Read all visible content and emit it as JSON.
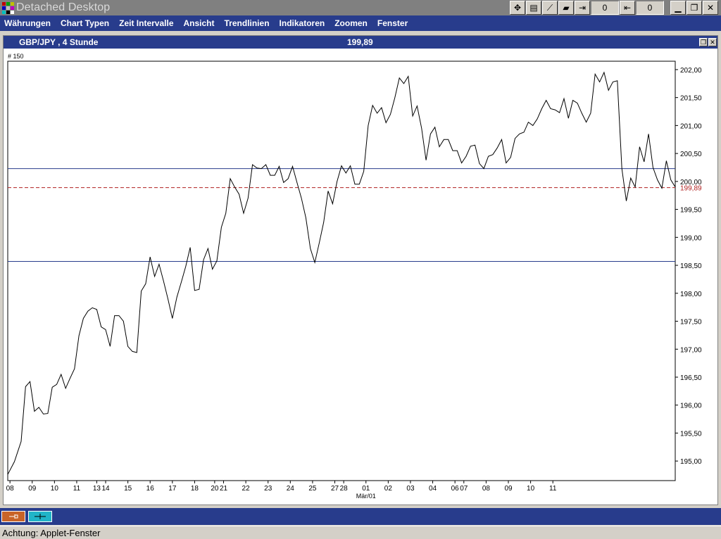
{
  "window": {
    "title": "Detached Desktop",
    "count_left": "0",
    "count_right": "0"
  },
  "menu": [
    "Währungen",
    "Chart Typen",
    "Zeit Intervalle",
    "Ansicht",
    "Trendlinien",
    "Indikatoren",
    "Zoomen",
    "Fenster"
  ],
  "chart_window": {
    "title": "GBP/JPY , 4 Stunde",
    "price": "199,89",
    "bar_count": "# 150"
  },
  "status": {
    "text": "Achtung: Applet-Fenster"
  },
  "colors": {
    "titlebar": "#808080",
    "menubar": "#283c8c",
    "last_price": "#b02020",
    "trendline": "#283c8c",
    "task1": "#c86428",
    "task2": "#20b4c8"
  },
  "chart_data": {
    "type": "line",
    "title": "GBP/JPY , 4 Stunde",
    "ylim": [
      194.65,
      202.15
    ],
    "y_ticks": [
      "195,00",
      "195,50",
      "196,00",
      "196,50",
      "197,00",
      "197,50",
      "198,00",
      "198,50",
      "199,00",
      "199,50",
      "200,00",
      "200,50",
      "201,00",
      "201,50",
      "202,00"
    ],
    "y_tick_values": [
      195.0,
      195.5,
      196.0,
      196.5,
      197.0,
      197.5,
      198.0,
      198.5,
      199.0,
      199.5,
      200.0,
      200.5,
      201.0,
      201.5,
      202.0
    ],
    "x_ticks": [
      "08",
      "09",
      "10",
      "11",
      "13",
      "14",
      "15",
      "16",
      "17",
      "18",
      "20",
      "21",
      "22",
      "23",
      "24",
      "25",
      "27",
      "28",
      "01",
      "02",
      "03",
      "04",
      "06",
      "07",
      "08",
      "09",
      "10",
      "11"
    ],
    "x_tick_index": [
      1,
      11,
      21,
      31,
      40,
      44,
      54,
      64,
      74,
      84,
      93,
      97,
      107,
      117,
      127,
      137,
      147,
      151,
      161,
      171,
      181,
      191,
      201,
      205,
      215,
      225,
      235,
      245
    ],
    "x_sublabel": "Mär/01",
    "x_sublabel_index": 161,
    "last_price": 199.89,
    "last_price_label": "199,89",
    "horizontal_lines": [
      200.23,
      198.57
    ],
    "series": [
      {
        "points": [
          [
            0,
            194.76
          ],
          [
            3,
            194.99
          ],
          [
            6,
            195.35
          ],
          [
            8,
            196.33
          ],
          [
            10,
            196.42
          ],
          [
            12,
            195.89
          ],
          [
            14,
            195.96
          ],
          [
            16,
            195.84
          ],
          [
            18,
            195.85
          ],
          [
            20,
            196.32
          ],
          [
            22,
            196.37
          ],
          [
            24,
            196.55
          ],
          [
            26,
            196.3
          ],
          [
            28,
            196.48
          ],
          [
            30,
            196.65
          ],
          [
            32,
            197.24
          ],
          [
            34,
            197.55
          ],
          [
            36,
            197.68
          ],
          [
            38,
            197.74
          ],
          [
            40,
            197.71
          ],
          [
            42,
            197.4
          ],
          [
            44,
            197.35
          ],
          [
            46,
            197.05
          ],
          [
            48,
            197.6
          ],
          [
            50,
            197.6
          ],
          [
            52,
            197.5
          ],
          [
            54,
            197.05
          ],
          [
            56,
            196.96
          ],
          [
            58,
            196.94
          ],
          [
            60,
            198.04
          ],
          [
            62,
            198.17
          ],
          [
            64,
            198.65
          ],
          [
            66,
            198.3
          ],
          [
            68,
            198.52
          ],
          [
            70,
            198.22
          ],
          [
            72,
            197.9
          ],
          [
            74,
            197.55
          ],
          [
            76,
            197.93
          ],
          [
            78,
            198.2
          ],
          [
            80,
            198.48
          ],
          [
            82,
            198.82
          ],
          [
            84,
            198.05
          ],
          [
            86,
            198.07
          ],
          [
            88,
            198.6
          ],
          [
            90,
            198.8
          ],
          [
            92,
            198.43
          ],
          [
            94,
            198.58
          ],
          [
            96,
            199.18
          ],
          [
            98,
            199.43
          ],
          [
            100,
            200.05
          ],
          [
            102,
            199.9
          ],
          [
            104,
            199.77
          ],
          [
            106,
            199.43
          ],
          [
            108,
            199.7
          ],
          [
            110,
            200.3
          ],
          [
            112,
            200.24
          ],
          [
            114,
            200.23
          ],
          [
            116,
            200.3
          ],
          [
            118,
            200.11
          ],
          [
            120,
            200.11
          ],
          [
            122,
            200.27
          ],
          [
            124,
            199.98
          ],
          [
            126,
            200.05
          ],
          [
            128,
            200.27
          ],
          [
            130,
            199.98
          ],
          [
            132,
            199.7
          ],
          [
            134,
            199.35
          ],
          [
            136,
            198.8
          ],
          [
            138,
            198.55
          ],
          [
            140,
            198.9
          ],
          [
            142,
            199.27
          ],
          [
            144,
            199.83
          ],
          [
            146,
            199.6
          ],
          [
            148,
            200.0
          ],
          [
            150,
            200.28
          ],
          [
            152,
            200.15
          ],
          [
            154,
            200.28
          ],
          [
            156,
            199.95
          ],
          [
            158,
            199.95
          ],
          [
            160,
            200.18
          ],
          [
            162,
            201.0
          ],
          [
            164,
            201.36
          ],
          [
            166,
            201.22
          ],
          [
            168,
            201.32
          ],
          [
            170,
            201.05
          ],
          [
            172,
            201.2
          ],
          [
            174,
            201.5
          ],
          [
            176,
            201.85
          ],
          [
            178,
            201.75
          ],
          [
            180,
            201.88
          ],
          [
            182,
            201.17
          ],
          [
            184,
            201.35
          ],
          [
            186,
            200.95
          ],
          [
            188,
            200.38
          ],
          [
            190,
            200.85
          ],
          [
            192,
            200.97
          ],
          [
            194,
            200.62
          ],
          [
            196,
            200.75
          ],
          [
            198,
            200.75
          ],
          [
            200,
            200.55
          ],
          [
            202,
            200.55
          ],
          [
            204,
            200.33
          ],
          [
            206,
            200.45
          ],
          [
            208,
            200.63
          ],
          [
            210,
            200.65
          ],
          [
            212,
            200.32
          ],
          [
            214,
            200.23
          ],
          [
            216,
            200.45
          ],
          [
            218,
            200.48
          ],
          [
            220,
            200.6
          ],
          [
            222,
            200.75
          ],
          [
            224,
            200.33
          ],
          [
            226,
            200.43
          ],
          [
            228,
            200.77
          ],
          [
            230,
            200.85
          ],
          [
            232,
            200.88
          ],
          [
            234,
            201.06
          ],
          [
            236,
            201.0
          ],
          [
            238,
            201.12
          ],
          [
            240,
            201.3
          ],
          [
            242,
            201.45
          ],
          [
            244,
            201.3
          ],
          [
            246,
            201.28
          ],
          [
            248,
            201.23
          ],
          [
            250,
            201.48
          ],
          [
            252,
            201.13
          ],
          [
            254,
            201.45
          ],
          [
            256,
            201.4
          ],
          [
            258,
            201.22
          ],
          [
            260,
            201.06
          ],
          [
            262,
            201.22
          ],
          [
            264,
            201.92
          ],
          [
            266,
            201.78
          ],
          [
            268,
            201.95
          ],
          [
            270,
            201.63
          ],
          [
            272,
            201.78
          ],
          [
            274,
            201.8
          ],
          [
            276,
            200.23
          ],
          [
            278,
            199.65
          ],
          [
            280,
            200.06
          ],
          [
            282,
            199.9
          ],
          [
            284,
            200.62
          ],
          [
            286,
            200.35
          ],
          [
            288,
            200.85
          ],
          [
            290,
            200.25
          ],
          [
            292,
            200.03
          ],
          [
            294,
            199.88
          ],
          [
            296,
            200.37
          ],
          [
            298,
            200.03
          ],
          [
            300,
            199.9
          ]
        ]
      }
    ]
  }
}
